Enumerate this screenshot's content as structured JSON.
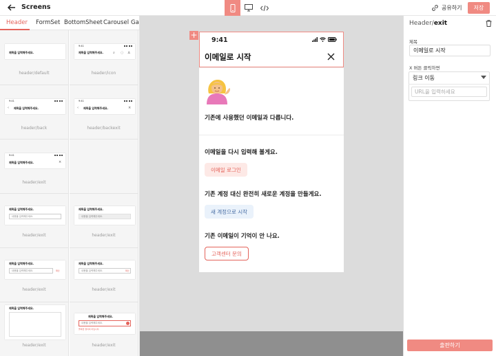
{
  "topbar": {
    "title": "Screens",
    "share_label": "공유하기",
    "save_label": "저장"
  },
  "categories": [
    "Header",
    "FormSet",
    "BottomSheet",
    "Carousel",
    "Gal"
  ],
  "thumbnails": {
    "status_time": "9:41",
    "placeholder_title": "제목을 입력해주세요.",
    "input_placeholder": "내용을 입력해주세요.",
    "input_value": "내용을 입력해주세요.",
    "error_text": "올바른 형식이 아닙니다.",
    "action_text": "확인",
    "labels": [
      "header/default",
      "header/icon",
      "header/back",
      "header/backexit",
      "header/exit",
      "header/exit",
      "header/exit",
      "header/exit",
      "header/exit",
      "header/exit",
      "header/exit"
    ]
  },
  "phone": {
    "time": "9:41",
    "title": "이메일로 시작",
    "message": "기존에 사용했던 이메일과 다릅니다.",
    "q1": "이메일을 다시 입력해 볼게요.",
    "btn1": "이메일 로그인",
    "q2": "기존 계정 대신 완전히 새로운 계정을 만들게요.",
    "btn2": "새 계정으로 시작",
    "q3": "기존 이메일이 기억이 안 나요.",
    "btn3": "고객센터 문의"
  },
  "inspector": {
    "component_prefix": "Header/",
    "component_name": "exit",
    "title_label": "제목",
    "title_value": "이메일로 시작",
    "x_action_label": "X 버튼 클릭하면",
    "x_action_value": "링크 이동",
    "url_placeholder": "URL을 입력하세요",
    "publish_label": "출판하기"
  },
  "colors": {
    "accent": "#f08a82",
    "accent_text": "#e4625a"
  },
  "icons": [
    "back-arrow-icon",
    "mobile-view-icon",
    "desktop-view-icon",
    "code-view-icon",
    "share-icon",
    "trash-icon",
    "close-icon",
    "plus-icon",
    "person-tipping-hand-emoji"
  ]
}
